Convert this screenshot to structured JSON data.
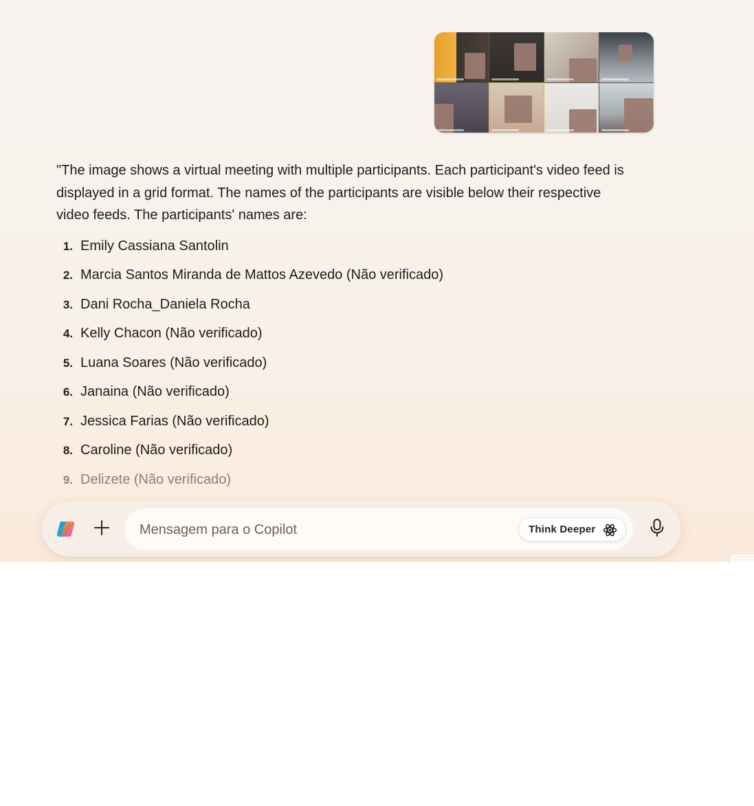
{
  "attachment": {
    "icon": "video-meeting-grid-thumbnail"
  },
  "response": {
    "intro": "\"The image shows a virtual meeting with multiple participants. Each participant's video feed is displayed in a grid format. The names of the participants are visible below their respective video feeds. The participants' names are:",
    "items": [
      {
        "num": "1.",
        "text": "Emily Cassiana Santolin"
      },
      {
        "num": "2.",
        "text": "Marcia Santos Miranda de Mattos Azevedo (Não verificado)"
      },
      {
        "num": "3.",
        "text": "Dani Rocha_Daniela Rocha"
      },
      {
        "num": "4.",
        "text": "Kelly Chacon (Não verificado)"
      },
      {
        "num": "5.",
        "text": "Luana Soares (Não verificado)"
      },
      {
        "num": "6.",
        "text": "Janaina (Não verificado)"
      },
      {
        "num": "7.",
        "text": "Jessica Farias (Não verificado)"
      },
      {
        "num": "8.",
        "text": "Caroline (Não verificado)"
      },
      {
        "num": "9.",
        "text": "Delizete (Não verificado)"
      }
    ]
  },
  "composer": {
    "placeholder": "Mensagem para o Copilot",
    "think_deeper_label": "Think Deeper",
    "icons": {
      "logo": "copilot-logo-icon",
      "add": "plus-icon",
      "think": "atom-icon",
      "mic": "microphone-icon"
    }
  },
  "colors": {
    "background_top": "#f7f3ef",
    "background_bottom": "#fbeadb",
    "text": "#1f1a17",
    "faded_text": "#8a7f78"
  }
}
